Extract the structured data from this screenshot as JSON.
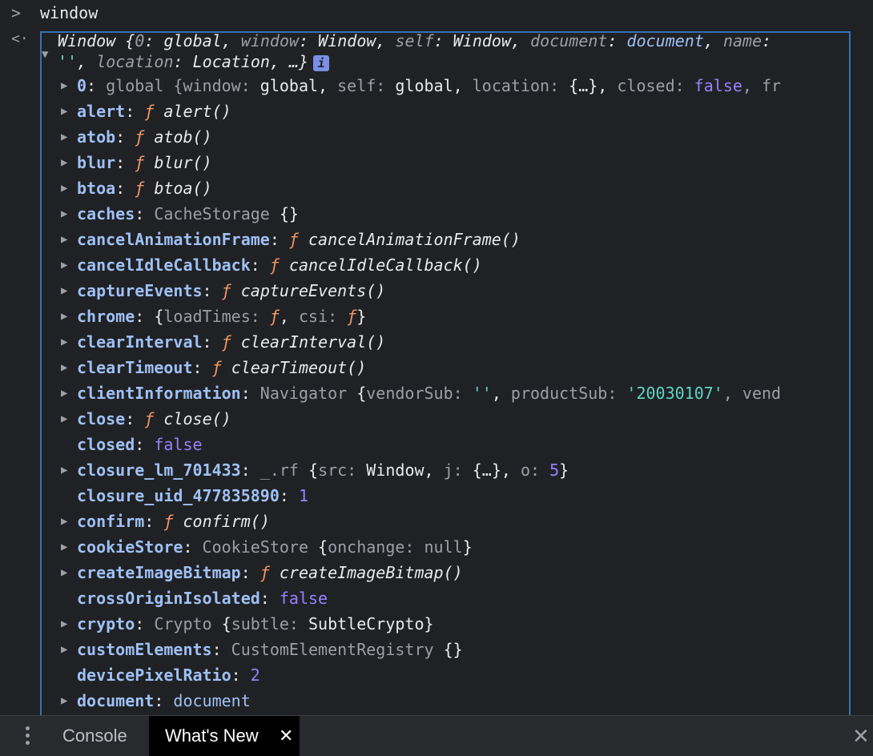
{
  "console": {
    "prompt_symbol": ">",
    "input": "window",
    "result_symbol": "<·",
    "header": {
      "line1_prefix": "Window {",
      "k0": "0",
      "v0": "global",
      "k1": "window",
      "v1": "Window",
      "k2": "self",
      "v2": "Window",
      "k3": "document",
      "v3": "document",
      "k4": "name",
      "line2_str": "''",
      "k5": "location",
      "v5": "Location",
      "tail": ", …}",
      "info_icon": "i"
    },
    "rows": [
      {
        "expand": true,
        "key": "0",
        "parts": [
          {
            "t": "global {",
            "c": "cls"
          },
          {
            "t": "window: ",
            "c": "hk"
          },
          {
            "t": "global",
            "c": "hv"
          },
          {
            "t": ", ",
            "c": "punc"
          },
          {
            "t": "self: ",
            "c": "hk"
          },
          {
            "t": "global",
            "c": "hv"
          },
          {
            "t": ", ",
            "c": "punc"
          },
          {
            "t": "location: ",
            "c": "hk"
          },
          {
            "t": "{…}",
            "c": "hv"
          },
          {
            "t": ", ",
            "c": "punc"
          },
          {
            "t": "closed: ",
            "c": "hk"
          },
          {
            "t": "false",
            "c": "bool"
          },
          {
            "t": ", fr",
            "c": "hk"
          }
        ]
      },
      {
        "expand": true,
        "key": "alert",
        "parts": [
          {
            "t": "ƒ ",
            "c": "f"
          },
          {
            "t": "alert()",
            "c": "fn"
          }
        ]
      },
      {
        "expand": true,
        "key": "atob",
        "parts": [
          {
            "t": "ƒ ",
            "c": "f"
          },
          {
            "t": "atob()",
            "c": "fn"
          }
        ]
      },
      {
        "expand": true,
        "key": "blur",
        "parts": [
          {
            "t": "ƒ ",
            "c": "f"
          },
          {
            "t": "blur()",
            "c": "fn"
          }
        ]
      },
      {
        "expand": true,
        "key": "btoa",
        "parts": [
          {
            "t": "ƒ ",
            "c": "f"
          },
          {
            "t": "btoa()",
            "c": "fn"
          }
        ]
      },
      {
        "expand": true,
        "key": "caches",
        "parts": [
          {
            "t": "CacheStorage ",
            "c": "cls"
          },
          {
            "t": "{}",
            "c": "punc"
          }
        ]
      },
      {
        "expand": true,
        "key": "cancelAnimationFrame",
        "parts": [
          {
            "t": "ƒ ",
            "c": "f"
          },
          {
            "t": "cancelAnimationFrame()",
            "c": "fn"
          }
        ]
      },
      {
        "expand": true,
        "key": "cancelIdleCallback",
        "parts": [
          {
            "t": "ƒ ",
            "c": "f"
          },
          {
            "t": "cancelIdleCallback()",
            "c": "fn"
          }
        ]
      },
      {
        "expand": true,
        "key": "captureEvents",
        "parts": [
          {
            "t": "ƒ ",
            "c": "f"
          },
          {
            "t": "captureEvents()",
            "c": "fn"
          }
        ]
      },
      {
        "expand": true,
        "key": "chrome",
        "parts": [
          {
            "t": "{",
            "c": "punc"
          },
          {
            "t": "loadTimes: ",
            "c": "hk"
          },
          {
            "t": "ƒ",
            "c": "f"
          },
          {
            "t": ", ",
            "c": "punc"
          },
          {
            "t": "csi: ",
            "c": "hk"
          },
          {
            "t": "ƒ",
            "c": "f"
          },
          {
            "t": "}",
            "c": "punc"
          }
        ]
      },
      {
        "expand": true,
        "key": "clearInterval",
        "parts": [
          {
            "t": "ƒ ",
            "c": "f"
          },
          {
            "t": "clearInterval()",
            "c": "fn"
          }
        ]
      },
      {
        "expand": true,
        "key": "clearTimeout",
        "parts": [
          {
            "t": "ƒ ",
            "c": "f"
          },
          {
            "t": "clearTimeout()",
            "c": "fn"
          }
        ]
      },
      {
        "expand": true,
        "key": "clientInformation",
        "parts": [
          {
            "t": "Navigator ",
            "c": "cls"
          },
          {
            "t": "{",
            "c": "punc"
          },
          {
            "t": "vendorSub: ",
            "c": "hk"
          },
          {
            "t": "''",
            "c": "str"
          },
          {
            "t": ", ",
            "c": "punc"
          },
          {
            "t": "productSub: ",
            "c": "hk"
          },
          {
            "t": "'20030107'",
            "c": "str"
          },
          {
            "t": ", vend",
            "c": "hk"
          }
        ]
      },
      {
        "expand": true,
        "key": "close",
        "parts": [
          {
            "t": "ƒ ",
            "c": "f"
          },
          {
            "t": "close()",
            "c": "fn"
          }
        ]
      },
      {
        "expand": false,
        "key": "closed",
        "parts": [
          {
            "t": "false",
            "c": "bool"
          }
        ]
      },
      {
        "expand": true,
        "key": "closure_lm_701433",
        "parts": [
          {
            "t": "_.rf ",
            "c": "cls"
          },
          {
            "t": "{",
            "c": "punc"
          },
          {
            "t": "src: ",
            "c": "hk"
          },
          {
            "t": "Window",
            "c": "hv"
          },
          {
            "t": ", ",
            "c": "punc"
          },
          {
            "t": "j: ",
            "c": "hk"
          },
          {
            "t": "{…}",
            "c": "hv"
          },
          {
            "t": ", ",
            "c": "punc"
          },
          {
            "t": "o: ",
            "c": "hk"
          },
          {
            "t": "5",
            "c": "num"
          },
          {
            "t": "}",
            "c": "punc"
          }
        ]
      },
      {
        "expand": false,
        "key": "closure_uid_477835890",
        "parts": [
          {
            "t": "1",
            "c": "num"
          }
        ]
      },
      {
        "expand": true,
        "key": "confirm",
        "parts": [
          {
            "t": "ƒ ",
            "c": "f"
          },
          {
            "t": "confirm()",
            "c": "fn"
          }
        ]
      },
      {
        "expand": true,
        "key": "cookieStore",
        "parts": [
          {
            "t": "CookieStore ",
            "c": "cls"
          },
          {
            "t": "{",
            "c": "punc"
          },
          {
            "t": "onchange: ",
            "c": "hk"
          },
          {
            "t": "null",
            "c": "hk"
          },
          {
            "t": "}",
            "c": "punc"
          }
        ]
      },
      {
        "expand": true,
        "key": "createImageBitmap",
        "parts": [
          {
            "t": "ƒ ",
            "c": "f"
          },
          {
            "t": "createImageBitmap()",
            "c": "fn"
          }
        ]
      },
      {
        "expand": false,
        "key": "crossOriginIsolated",
        "parts": [
          {
            "t": "false",
            "c": "bool"
          }
        ]
      },
      {
        "expand": true,
        "key": "crypto",
        "parts": [
          {
            "t": "Crypto ",
            "c": "cls"
          },
          {
            "t": "{",
            "c": "punc"
          },
          {
            "t": "subtle: ",
            "c": "hk"
          },
          {
            "t": "SubtleCrypto",
            "c": "hv"
          },
          {
            "t": "}",
            "c": "punc"
          }
        ]
      },
      {
        "expand": true,
        "key": "customElements",
        "parts": [
          {
            "t": "CustomElementRegistry ",
            "c": "cls"
          },
          {
            "t": "{}",
            "c": "punc"
          }
        ]
      },
      {
        "expand": false,
        "key": "devicePixelRatio",
        "parts": [
          {
            "t": "2",
            "c": "num"
          }
        ]
      },
      {
        "expand": true,
        "key": "document",
        "parts": [
          {
            "t": "document",
            "c": "doc"
          }
        ]
      }
    ]
  },
  "drawer": {
    "tab_console": "Console",
    "tab_whatsnew": "What's New",
    "tab_close": "✕",
    "drawer_close": "✕"
  },
  "colors": {
    "accent_border": "#3870b3",
    "key": "#9ec0f5",
    "function": "#f29766",
    "string": "#5cd5c4",
    "number": "#9980ff"
  },
  "icons": [
    "prompt-chevron-icon",
    "result-arrow-icon",
    "expand-triangle-icon",
    "info-icon",
    "more-menu-icon",
    "close-icon"
  ]
}
